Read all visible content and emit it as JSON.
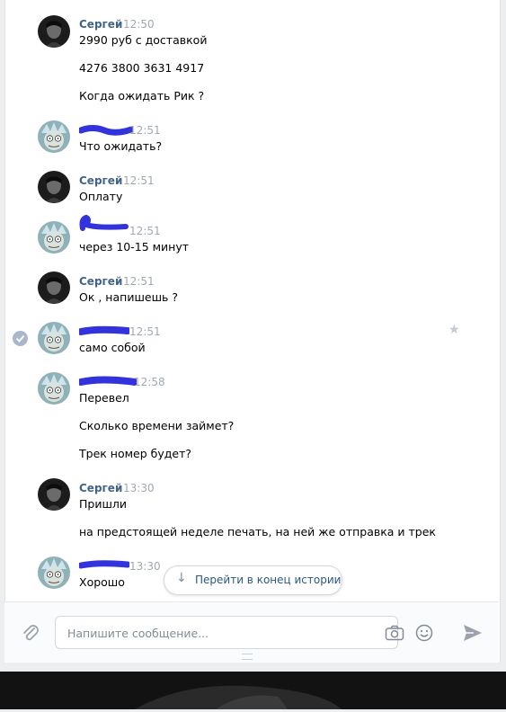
{
  "messages": [
    {
      "author": "Сергей",
      "time": "12:50",
      "avatar": "sergey",
      "lines": [
        "2990 руб с доставкой",
        "4276 3800 3631 4917",
        "Когда ожидать Рик ?"
      ]
    },
    {
      "author": "",
      "time": "12:51",
      "avatar": "rick",
      "lines": [
        "Что ожидать?"
      ]
    },
    {
      "author": "Сергей",
      "time": "12:51",
      "avatar": "sergey",
      "lines": [
        "Оплату"
      ]
    },
    {
      "author": "",
      "time": "12:51",
      "avatar": "rick",
      "lines": [
        "через 10-15 минут"
      ]
    },
    {
      "author": "Сергей",
      "time": "12:51",
      "avatar": "sergey",
      "lines": [
        "Ок , напишешь ?"
      ]
    },
    {
      "author": "",
      "time": "12:51",
      "avatar": "rick",
      "lines": [
        "само собой"
      ]
    },
    {
      "author": "",
      "time": "12:58",
      "avatar": "rick",
      "lines": [
        "Перевел",
        "Сколько времени займет?",
        "Трек номер будет?"
      ]
    },
    {
      "author": "Сергей",
      "time": "13:30",
      "avatar": "sergey",
      "lines": [
        "Пришли",
        "на предстоящей неделе печать, на ней же отправка и трек"
      ]
    },
    {
      "author": "",
      "time": "13:30",
      "avatar": "rick",
      "lines": [
        "Хорошо"
      ]
    }
  ],
  "jump_to_end": {
    "label": "Перейти в конец истории",
    "icon": "arrow-down-icon"
  },
  "composer": {
    "placeholder": "Напишите сообщение...",
    "icons": [
      "attach-icon",
      "camera-icon",
      "smile-icon",
      "send-icon"
    ]
  },
  "colors": {
    "accent": "#42648b",
    "link": "#2a5885",
    "time": "#a0a8b3",
    "redaction": "#3333dd"
  }
}
